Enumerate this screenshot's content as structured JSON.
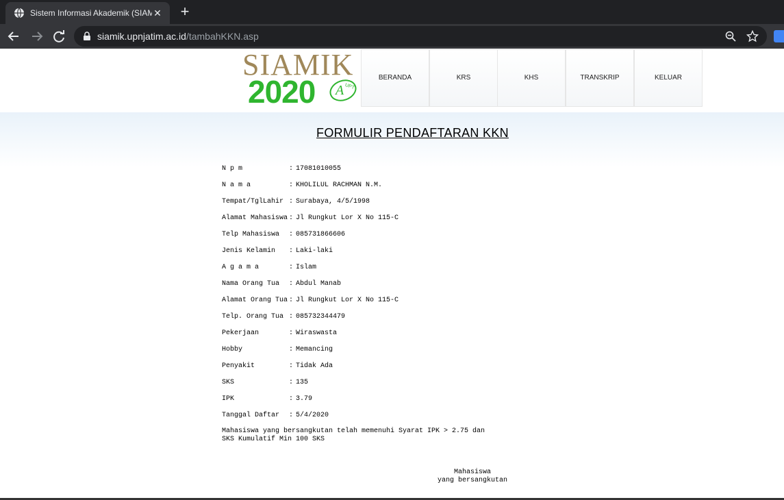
{
  "browser": {
    "tab_title": "Sistem Informasi Akademik (SIAMIK)",
    "url_host": "siamik.upnjatim.ac.id",
    "url_path": "/tambahKKN.asp"
  },
  "logo": {
    "top_text": "SIAMIK",
    "year_text": "2020",
    "seal_text": "AUPT"
  },
  "nav": [
    "BERANDA",
    "KRS",
    "KHS",
    "TRANSKRIP",
    "KELUAR"
  ],
  "form": {
    "title": "FORMULIR PENDAFTARAN KKN",
    "fields": [
      {
        "label": "N p m",
        "value": "17081010055"
      },
      {
        "label": "N a m a",
        "value": "KHOLILUL RACHMAN N.M."
      },
      {
        "label": "Tempat/TglLahir",
        "value": "Surabaya, 4/5/1998"
      },
      {
        "label": "Alamat Mahasiswa",
        "value": "Jl Rungkut Lor X No 115-C"
      },
      {
        "label": "Telp Mahasiswa",
        "value": "085731866606"
      },
      {
        "label": "Jenis Kelamin",
        "value": "Laki-laki"
      },
      {
        "label": "A g a m a",
        "value": "Islam"
      },
      {
        "label": "Nama Orang Tua",
        "value": "Abdul Manab"
      },
      {
        "label": "Alamat Orang Tua",
        "value": "Jl Rungkut Lor X No 115-C"
      },
      {
        "label": "Telp. Orang Tua",
        "value": "085732344479"
      },
      {
        "label": "Pekerjaan",
        "value": "Wiraswasta"
      },
      {
        "label": "Hobby",
        "value": "Memancing"
      },
      {
        "label": "Penyakit",
        "value": "Tidak Ada"
      },
      {
        "label": "SKS",
        "value": "135"
      },
      {
        "label": "IPK",
        "value": "3.79"
      },
      {
        "label": "Tanggal Daftar",
        "value": "5/4/2020"
      }
    ],
    "separator": ":",
    "note_line1": "Mahasiswa yang bersangkutan telah memenuhi Syarat IPK > 2.75 dan",
    "note_line2": "SKS Kumulatif Min 100 SKS",
    "sign_line1": "Mahasiswa",
    "sign_line2": "yang bersangkutan"
  },
  "colors": {
    "logo_gold": "#a0885a",
    "logo_green": "#2fb52f"
  }
}
